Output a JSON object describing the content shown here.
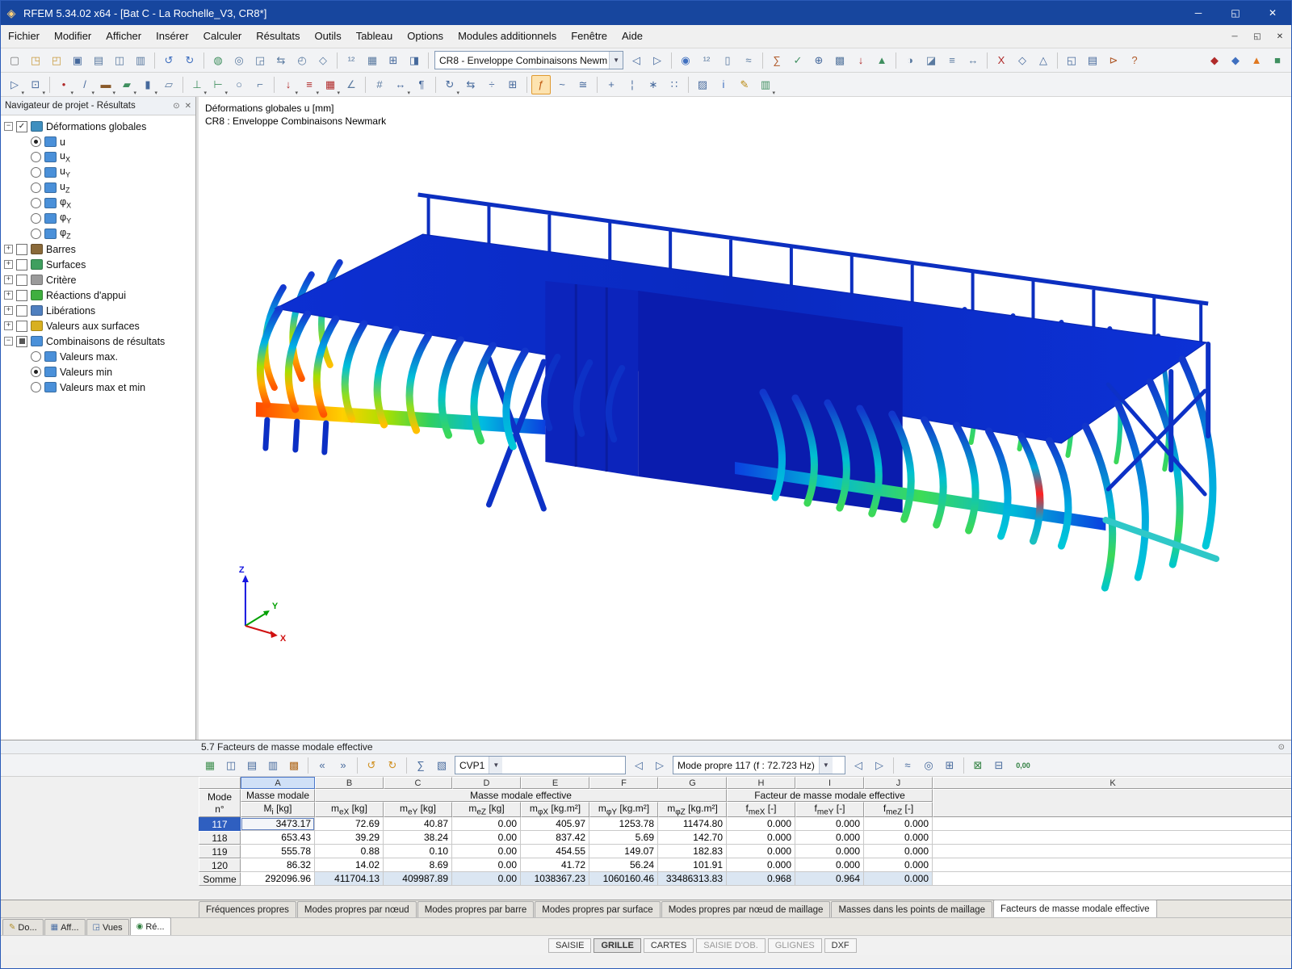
{
  "window": {
    "title": "RFEM 5.34.02 x64 - [Bat C - La Rochelle_V3, CR8*]",
    "controls": [
      {
        "n": "minimize-button",
        "g": "─"
      },
      {
        "n": "maximize-button",
        "g": "◱"
      },
      {
        "n": "close-button",
        "g": "✕"
      }
    ]
  },
  "menu": [
    "Fichier",
    "Modifier",
    "Afficher",
    "Insérer",
    "Calculer",
    "Résultats",
    "Outils",
    "Tableau",
    "Options",
    "Modules additionnels",
    "Fenêtre",
    "Aide"
  ],
  "mdi_controls": [
    {
      "n": "mdi-minimize-button",
      "g": "─"
    },
    {
      "n": "mdi-restore-button",
      "g": "◱"
    },
    {
      "n": "mdi-close-button",
      "g": "✕"
    }
  ],
  "toolbar1": {
    "case_combo": "CR8 - Enveloppe Combinaisons Newm",
    "icons_a": [
      {
        "n": "new-model",
        "g": "▢",
        "c": "#7a7a7a"
      },
      {
        "n": "open-project",
        "g": "◳",
        "c": "#c99b3f"
      },
      {
        "n": "open-model",
        "g": "◰",
        "c": "#c99b3f"
      },
      {
        "n": "save",
        "g": "▣",
        "c": "#46699c"
      },
      {
        "n": "print",
        "g": "▤",
        "c": "#5a7aa0"
      },
      {
        "n": "copy",
        "g": "◫",
        "c": "#5a7aa0"
      },
      {
        "n": "paste",
        "g": "▥",
        "c": "#5a7aa0"
      },
      {
        "sep": true
      },
      {
        "n": "undo",
        "g": "↺",
        "c": "#3f6fbf"
      },
      {
        "n": "redo",
        "g": "↻",
        "c": "#3f6fbf"
      },
      {
        "sep": true
      },
      {
        "n": "render",
        "g": "◍",
        "c": "#3f8f5f"
      },
      {
        "n": "zoom",
        "g": "◎",
        "c": "#5a7aa0"
      },
      {
        "n": "zoom-window",
        "g": "◲",
        "c": "#5a7aa0"
      },
      {
        "n": "pan",
        "g": "⇆",
        "c": "#5a7aa0"
      },
      {
        "n": "previous-view",
        "g": "◴",
        "c": "#5a7aa0"
      },
      {
        "n": "full-view",
        "g": "◇",
        "c": "#5a7aa0"
      },
      {
        "sep": true
      },
      {
        "n": "numbering-display",
        "g": "¹²",
        "c": "#5a7aa0"
      },
      {
        "n": "display-settings",
        "g": "▦",
        "c": "#5a7aa0"
      },
      {
        "n": "tables-toggle",
        "g": "⊞",
        "c": "#46699c"
      },
      {
        "n": "panel-toggle",
        "g": "◨",
        "c": "#46699c"
      },
      {
        "sep": true
      }
    ],
    "icons_b": [
      {
        "n": "previous-load-case",
        "g": "◁",
        "c": "#46699c"
      },
      {
        "n": "next-load-case",
        "g": "▷",
        "c": "#46699c"
      },
      {
        "sep": true
      },
      {
        "n": "show-results",
        "g": "◉",
        "c": "#3f6fbf"
      },
      {
        "n": "result-values",
        "g": "¹²",
        "c": "#5a7aa0"
      },
      {
        "n": "panel-legend",
        "g": "▯",
        "c": "#5a7aa0"
      },
      {
        "n": "animation",
        "g": "≈",
        "c": "#5a7aa0"
      },
      {
        "sep": true
      },
      {
        "n": "calculate",
        "g": "∑",
        "c": "#b05a2a"
      },
      {
        "n": "check",
        "g": "✓",
        "c": "#3f8f5f"
      },
      {
        "n": "generators",
        "g": "⊕",
        "c": "#46699c"
      },
      {
        "n": "fe-mesh",
        "g": "▩",
        "c": "#5a7aa0"
      },
      {
        "n": "loads-display",
        "g": "↓",
        "c": "#b02a2a"
      },
      {
        "n": "supports-display",
        "g": "▲",
        "c": "#3f8f5f"
      },
      {
        "sep": true
      },
      {
        "n": "visibilities",
        "g": "◑",
        "c": "#5a7aa0"
      },
      {
        "n": "section",
        "g": "◪",
        "c": "#5a7aa0"
      },
      {
        "n": "background",
        "g": "≡",
        "c": "#5a7aa0"
      },
      {
        "n": "measure",
        "g": "↔",
        "c": "#5a7aa0"
      },
      {
        "sep": true
      },
      {
        "n": "view-x",
        "g": "X",
        "c": "#b02a2a"
      },
      {
        "n": "view-isometric",
        "g": "◇",
        "c": "#46699c"
      },
      {
        "n": "view-perspective",
        "g": "△",
        "c": "#46699c"
      },
      {
        "sep": true
      },
      {
        "n": "new-window",
        "g": "◱",
        "c": "#46699c"
      },
      {
        "n": "print-graphic",
        "g": "▤",
        "c": "#46699c"
      },
      {
        "n": "send-model",
        "g": "⊳",
        "c": "#b05a2a"
      },
      {
        "n": "help",
        "g": "?",
        "c": "#b05a2a"
      },
      {
        "space": true
      },
      {
        "n": "module-addon-1",
        "g": "◆",
        "c": "#b02a2a"
      },
      {
        "n": "module-addon-2",
        "g": "◆",
        "c": "#3f6fbf"
      },
      {
        "n": "module-addon-3",
        "g": "▲",
        "c": "#e07820"
      },
      {
        "n": "module-addon-4",
        "g": "■",
        "c": "#3f8f5f"
      }
    ]
  },
  "toolbar2": {
    "icons": [
      {
        "n": "select",
        "g": "▷",
        "c": "#46699c",
        "caret": true
      },
      {
        "n": "select-special",
        "g": "⊡",
        "c": "#46699c",
        "caret": true
      },
      {
        "sep": true
      },
      {
        "n": "new-node",
        "g": "•",
        "c": "#b02a2a",
        "caret": true
      },
      {
        "n": "new-line",
        "g": "/",
        "c": "#46699c",
        "caret": true
      },
      {
        "n": "new-member",
        "g": "▬",
        "c": "#8a5a2a",
        "caret": true
      },
      {
        "n": "new-surface",
        "g": "▰",
        "c": "#3f8f5f",
        "caret": true
      },
      {
        "n": "new-solid",
        "g": "▮",
        "c": "#46699c",
        "caret": true
      },
      {
        "n": "new-opening",
        "g": "▱",
        "c": "#5a7aa0"
      },
      {
        "sep": true
      },
      {
        "n": "nodal-support",
        "g": "⊥",
        "c": "#3f8f5f",
        "caret": true
      },
      {
        "n": "line-support",
        "g": "⊢",
        "c": "#3f8f5f",
        "caret": true
      },
      {
        "n": "member-hinge",
        "g": "○",
        "c": "#5a7aa0"
      },
      {
        "n": "eccentricity",
        "g": "⌐",
        "c": "#5a7aa0"
      },
      {
        "sep": true
      },
      {
        "n": "load-case-new",
        "g": "↓",
        "c": "#b02a2a",
        "caret": true
      },
      {
        "n": "member-load",
        "g": "≡",
        "c": "#b02a2a",
        "caret": true
      },
      {
        "n": "surface-load",
        "g": "▦",
        "c": "#b02a2a",
        "caret": true
      },
      {
        "n": "imperfection",
        "g": "∠",
        "c": "#5a7aa0"
      },
      {
        "sep": true
      },
      {
        "n": "numbering",
        "g": "#",
        "c": "#5a7aa0"
      },
      {
        "n": "dimensions",
        "g": "↔",
        "c": "#46699c",
        "caret": true
      },
      {
        "n": "comment",
        "g": "¶",
        "c": "#46699c"
      },
      {
        "sep": true
      },
      {
        "n": "edit-rotate",
        "g": "↻",
        "c": "#46699c",
        "caret": true
      },
      {
        "n": "edit-mirror",
        "g": "⇆",
        "c": "#46699c"
      },
      {
        "n": "edit-divide",
        "g": "÷",
        "c": "#46699c"
      },
      {
        "n": "edit-connect",
        "g": "⊞",
        "c": "#46699c"
      },
      {
        "sep": true
      },
      {
        "n": "result-values-display",
        "g": "ƒ",
        "c": "#c05a10",
        "active": true
      },
      {
        "n": "result-diagrams",
        "g": "~",
        "c": "#46699c"
      },
      {
        "n": "smooth-ranges",
        "g": "≅",
        "c": "#46699c"
      },
      {
        "sep": true
      },
      {
        "n": "ucs",
        "g": "+",
        "c": "#46699c"
      },
      {
        "n": "guidelines",
        "g": "¦",
        "c": "#46699c"
      },
      {
        "n": "snap",
        "g": "∗",
        "c": "#46699c"
      },
      {
        "n": "grid",
        "g": "∷",
        "c": "#46699c"
      },
      {
        "sep": true
      },
      {
        "n": "layers",
        "g": "▨",
        "c": "#46699c"
      },
      {
        "n": "info",
        "g": "i",
        "c": "#3f6fbf"
      },
      {
        "n": "pencil",
        "g": "✎",
        "c": "#b8860b"
      },
      {
        "n": "color-scale",
        "g": "▥",
        "c": "#3f8f5f",
        "caret": true
      }
    ]
  },
  "navigator": {
    "title": "Navigateur de projet - Résultats",
    "tree": [
      {
        "level": 0,
        "exp": "minus",
        "ctl": "cb",
        "state": "on",
        "ic": "#3f8fbf",
        "label": "Déformations globales"
      },
      {
        "level": 1,
        "ctl": "rb",
        "state": "on",
        "ic": "#4a90d9",
        "label": "u"
      },
      {
        "level": 1,
        "ctl": "rb",
        "state": "off",
        "ic": "#4a90d9",
        "label": "u",
        "sub": "X"
      },
      {
        "level": 1,
        "ctl": "rb",
        "state": "off",
        "ic": "#4a90d9",
        "label": "u",
        "sub": "Y"
      },
      {
        "level": 1,
        "ctl": "rb",
        "state": "off",
        "ic": "#4a90d9",
        "label": "u",
        "sub": "Z"
      },
      {
        "level": 1,
        "ctl": "rb",
        "state": "off",
        "ic": "#4a90d9",
        "label": "φ",
        "sub": "X"
      },
      {
        "level": 1,
        "ctl": "rb",
        "state": "off",
        "ic": "#4a90d9",
        "label": "φ",
        "sub": "Y"
      },
      {
        "level": 1,
        "ctl": "rb",
        "state": "off",
        "ic": "#4a90d9",
        "label": "φ",
        "sub": "Z"
      },
      {
        "level": 0,
        "exp": "plus",
        "ctl": "cb",
        "state": "off",
        "ic": "#8a6a3a",
        "label": "Barres"
      },
      {
        "level": 0,
        "exp": "plus",
        "ctl": "cb",
        "state": "off",
        "ic": "#3f9f5f",
        "label": "Surfaces"
      },
      {
        "level": 0,
        "exp": "plus",
        "ctl": "cb",
        "state": "off",
        "ic": "#9a9a9a",
        "label": "Critère"
      },
      {
        "level": 0,
        "exp": "plus",
        "ctl": "cb",
        "state": "off",
        "ic": "#3faf3f",
        "label": "Réactions d'appui"
      },
      {
        "level": 0,
        "exp": "plus",
        "ctl": "cb",
        "state": "off",
        "ic": "#4f7fbf",
        "label": "Libérations"
      },
      {
        "level": 0,
        "exp": "plus",
        "ctl": "cb",
        "state": "off",
        "ic": "#d8b020",
        "label": "Valeurs aux surfaces"
      },
      {
        "level": 0,
        "exp": "minus",
        "ctl": "cb",
        "state": "part",
        "ic": "#4a90d9",
        "label": "Combinaisons de résultats"
      },
      {
        "level": 1,
        "ctl": "rb",
        "state": "off",
        "ic": "#4a90d9",
        "label": "Valeurs max."
      },
      {
        "level": 1,
        "ctl": "rb",
        "state": "on",
        "ic": "#4a90d9",
        "label": "Valeurs min"
      },
      {
        "level": 1,
        "ctl": "rb",
        "state": "off",
        "ic": "#4a90d9",
        "label": "Valeurs max et min"
      }
    ],
    "bottom_tabs": [
      {
        "n": "tab-donnees",
        "label": "Do...",
        "g": "✎",
        "c": "#b08f2f"
      },
      {
        "n": "tab-afficher",
        "label": "Aff...",
        "g": "▦",
        "c": "#4a6fa5"
      },
      {
        "n": "tab-vues",
        "label": "Vues",
        "g": "◲",
        "c": "#4a6fa5"
      },
      {
        "n": "tab-resultats",
        "label": "Ré...",
        "g": "◉",
        "c": "#2f7f3f",
        "active": true
      }
    ]
  },
  "viewport": {
    "overlay_line1": "Déformations globales u [mm]",
    "overlay_line2": "CR8 : Enveloppe Combinaisons Newmark",
    "axes": {
      "x": "X",
      "y": "Y",
      "z": "Z"
    }
  },
  "table": {
    "title": "5.7 Facteurs de masse modale effective",
    "cvp_combo": "CVP1",
    "mode_combo": "Mode propre 117 (f : 72.723 Hz)",
    "col_letters": [
      "A",
      "B",
      "C",
      "D",
      "E",
      "F",
      "G",
      "H",
      "I",
      "J",
      "K"
    ],
    "group": {
      "mode_line1": "Mode",
      "mode_line2": "n°",
      "masse": "Masse modale",
      "mme": "Masse modale effective",
      "fmme": "Facteur de masse modale effective"
    },
    "subheaders": [
      {
        "b": "M",
        "s": "i",
        "u": "[kg]"
      },
      {
        "b": "m",
        "s": "eX",
        "u": "[kg]"
      },
      {
        "b": "m",
        "s": "eY",
        "u": "[kg]"
      },
      {
        "b": "m",
        "s": "eZ",
        "u": "[kg]"
      },
      {
        "b": "m",
        "s": "φX",
        "u": "[kg.m²]"
      },
      {
        "b": "m",
        "s": "φY",
        "u": "[kg.m²]"
      },
      {
        "b": "m",
        "s": "φZ",
        "u": "[kg.m²]"
      },
      {
        "b": "f",
        "s": "meX",
        "u": "[-]"
      },
      {
        "b": "f",
        "s": "meY",
        "u": "[-]"
      },
      {
        "b": "f",
        "s": "meZ",
        "u": "[-]"
      }
    ],
    "rows": [
      {
        "mode": "117",
        "selected": true,
        "v": [
          "3473.17",
          "72.69",
          "40.87",
          "0.00",
          "405.97",
          "1253.78",
          "11474.80",
          "0.000",
          "0.000",
          "0.000"
        ]
      },
      {
        "mode": "118",
        "v": [
          "653.43",
          "39.29",
          "38.24",
          "0.00",
          "837.42",
          "5.69",
          "142.70",
          "0.000",
          "0.000",
          "0.000"
        ]
      },
      {
        "mode": "119",
        "v": [
          "555.78",
          "0.88",
          "0.10",
          "0.00",
          "454.55",
          "149.07",
          "182.83",
          "0.000",
          "0.000",
          "0.000"
        ]
      },
      {
        "mode": "120",
        "v": [
          "86.32",
          "14.02",
          "8.69",
          "0.00",
          "41.72",
          "56.24",
          "101.91",
          "0.000",
          "0.000",
          "0.000"
        ]
      },
      {
        "mode": "Somme",
        "sum": true,
        "v": [
          "292096.96",
          "411704.13",
          "409987.89",
          "0.00",
          "1038367.23",
          "1060160.46",
          "33486313.83",
          "0.968",
          "0.964",
          "0.000"
        ]
      }
    ],
    "toolbar_left": [
      {
        "n": "table-display-settings",
        "g": "▦",
        "c": "#3f8f4f"
      },
      {
        "n": "table-views",
        "g": "◫",
        "c": "#46699c"
      },
      {
        "n": "table-filter",
        "g": "▤",
        "c": "#46699c"
      },
      {
        "n": "table-columns",
        "g": "▥",
        "c": "#46699c"
      },
      {
        "n": "table-color-reference",
        "g": "▩",
        "c": "#b06a20"
      },
      {
        "sep": true
      },
      {
        "n": "table-import",
        "g": "«",
        "c": "#46699c"
      },
      {
        "n": "table-export",
        "g": "»",
        "c": "#46699c"
      },
      {
        "sep": true
      },
      {
        "n": "table-undo",
        "g": "↺",
        "c": "#d09020"
      },
      {
        "n": "table-redo",
        "g": "↻",
        "c": "#d09020"
      },
      {
        "sep": true
      },
      {
        "n": "table-sum",
        "g": "∑",
        "c": "#46699c"
      },
      {
        "n": "table-statistics",
        "g": "▧",
        "c": "#46699c"
      }
    ],
    "toolbar_right": [
      {
        "sep": true
      },
      {
        "n": "mode-shape-animation",
        "g": "≈",
        "c": "#46699c"
      },
      {
        "n": "table-search",
        "g": "◎",
        "c": "#46699c"
      },
      {
        "n": "table-relations",
        "g": "⊞",
        "c": "#46699c"
      },
      {
        "sep": true
      },
      {
        "n": "export-excel",
        "g": "⊠",
        "c": "#2f7f3f"
      },
      {
        "n": "calculator",
        "g": "⊟",
        "c": "#46699c"
      },
      {
        "n": "decimal-places",
        "g": "0,00",
        "c": "#2f7f3f",
        "wide": true
      }
    ],
    "tabs": [
      {
        "label": "Fréquences propres"
      },
      {
        "label": "Modes propres par nœud"
      },
      {
        "label": "Modes propres par barre"
      },
      {
        "label": "Modes propres par surface"
      },
      {
        "label": "Modes propres par nœud de maillage"
      },
      {
        "label": "Masses dans les points de maillage"
      },
      {
        "label": "Facteurs de masse modale effective",
        "active": true
      }
    ]
  },
  "statusbar": [
    {
      "label": "SAISIE"
    },
    {
      "label": "GRILLE",
      "active": true
    },
    {
      "label": "CARTES"
    },
    {
      "label": "SAISIE D'OB.",
      "dim": true
    },
    {
      "label": "GLIGNES",
      "dim": true
    },
    {
      "label": "DXF"
    }
  ],
  "colors": {
    "titlebar": "#17469e",
    "selection": "#2f5fc0",
    "sum_row": "#dbe6f2",
    "column_selected": "#cfe0f7",
    "active_tool_highlight": "#fde3b0"
  }
}
